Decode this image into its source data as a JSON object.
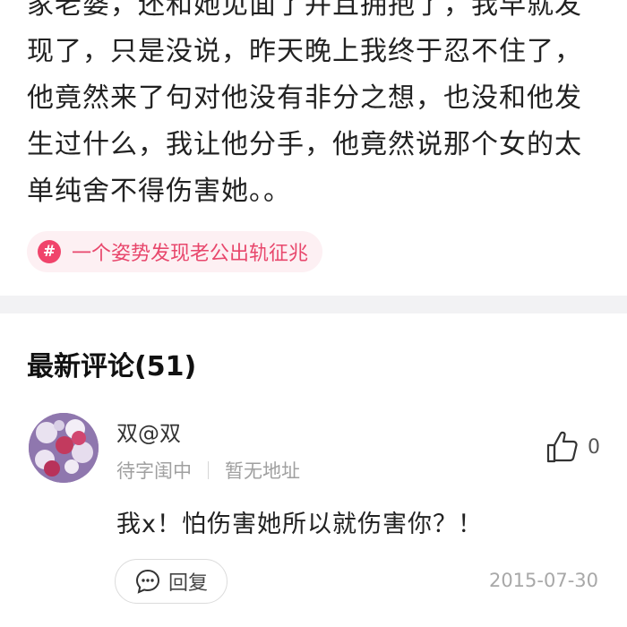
{
  "post": {
    "lines": [
      "家老婆，还和她见面了并且拥抱了，我早就发",
      "现了，只是没说，昨天晚上我终于忍不住了，",
      "他竟然来了句对他没有非分之想，也没和他发",
      "生过什么，我让他分手，他竟然说那个女的太",
      "单纯舍不得伤害她。。"
    ],
    "topic_tag": {
      "icon": "hash-icon",
      "symbol": "#",
      "label": "一个姿势发现老公出轨征兆"
    }
  },
  "comments_section": {
    "title": "最新评论(51)",
    "comments": [
      {
        "username": "双@双",
        "status": "待字闺中",
        "location": "暂无地址",
        "likes": "0",
        "text": "我x！怕伤害她所以就伤害你？！",
        "reply_label": "回复",
        "date": "2015-07-30"
      }
    ]
  },
  "colors": {
    "accent": "#f0446b",
    "tag_bg": "#fdf0f3",
    "meta_text": "#a0a0a0",
    "divider": "#f2f2f4"
  }
}
